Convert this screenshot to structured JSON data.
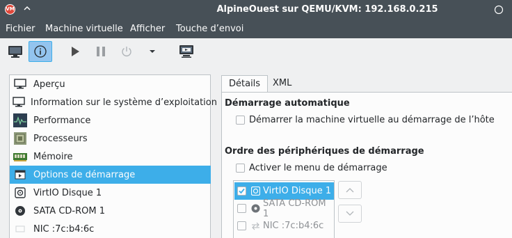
{
  "window": {
    "title": "AlpineOuest sur QEMU/KVM: 192.168.0.215",
    "app_icon_text": "VM"
  },
  "menubar": {
    "items": [
      "Fichier",
      "Machine virtuelle",
      "Afficher",
      "Touche d’envoi"
    ]
  },
  "toolbar": {
    "buttons": [
      {
        "icon": "monitor-icon",
        "active": false
      },
      {
        "icon": "info-icon",
        "active": true
      },
      {
        "icon": "play-icon",
        "active": false
      },
      {
        "icon": "pause-icon",
        "active": false
      },
      {
        "icon": "power-icon",
        "active": false
      },
      {
        "icon": "chevron-down-icon",
        "active": false
      },
      {
        "icon": "snapshot-icon",
        "active": false
      }
    ]
  },
  "sidebar": {
    "items": [
      {
        "label": "Aperçu",
        "icon": "monitor-icon",
        "selected": false
      },
      {
        "label": "Information sur le système d’exploitation",
        "icon": "monitor-icon",
        "selected": false
      },
      {
        "label": "Performance",
        "icon": "performance-icon",
        "selected": false
      },
      {
        "label": "Processeurs",
        "icon": "cpu-icon",
        "selected": false
      },
      {
        "label": "Mémoire",
        "icon": "memory-icon",
        "selected": false
      },
      {
        "label": "Options de démarrage",
        "icon": "boot-options-icon",
        "selected": true
      },
      {
        "label": "VirtIO Disque 1",
        "icon": "disk-icon",
        "selected": false
      },
      {
        "label": "SATA CD-ROM 1",
        "icon": "cdrom-icon",
        "selected": false
      },
      {
        "label": "NIC :7c:b4:6c",
        "icon": "nic-icon",
        "selected": false
      }
    ]
  },
  "tabs": [
    {
      "label": "Détails",
      "active": true
    },
    {
      "label": "XML",
      "active": false
    }
  ],
  "details": {
    "autostart_title": "Démarrage automatique",
    "autostart_checkbox": "Démarrer la machine virtuelle au démarrage de l’hôte",
    "boot_order_title": "Ordre des périphériques de démarrage",
    "boot_menu_checkbox": "Activer le menu de démarrage",
    "boot_devices": [
      {
        "label": "VirtIO Disque 1",
        "icon": "disk-icon",
        "checked": true,
        "selected": true
      },
      {
        "label": "SATA CD-ROM 1",
        "icon": "cdrom-icon",
        "checked": false,
        "selected": false
      },
      {
        "label": "NIC :7c:b4:6c",
        "icon": "nic-icon",
        "checked": false,
        "selected": false
      }
    ]
  },
  "colors": {
    "titlebar": "#475057",
    "accent": "#3daee9",
    "window_bg": "#eff0f1",
    "view_bg": "#fcfcfc"
  }
}
